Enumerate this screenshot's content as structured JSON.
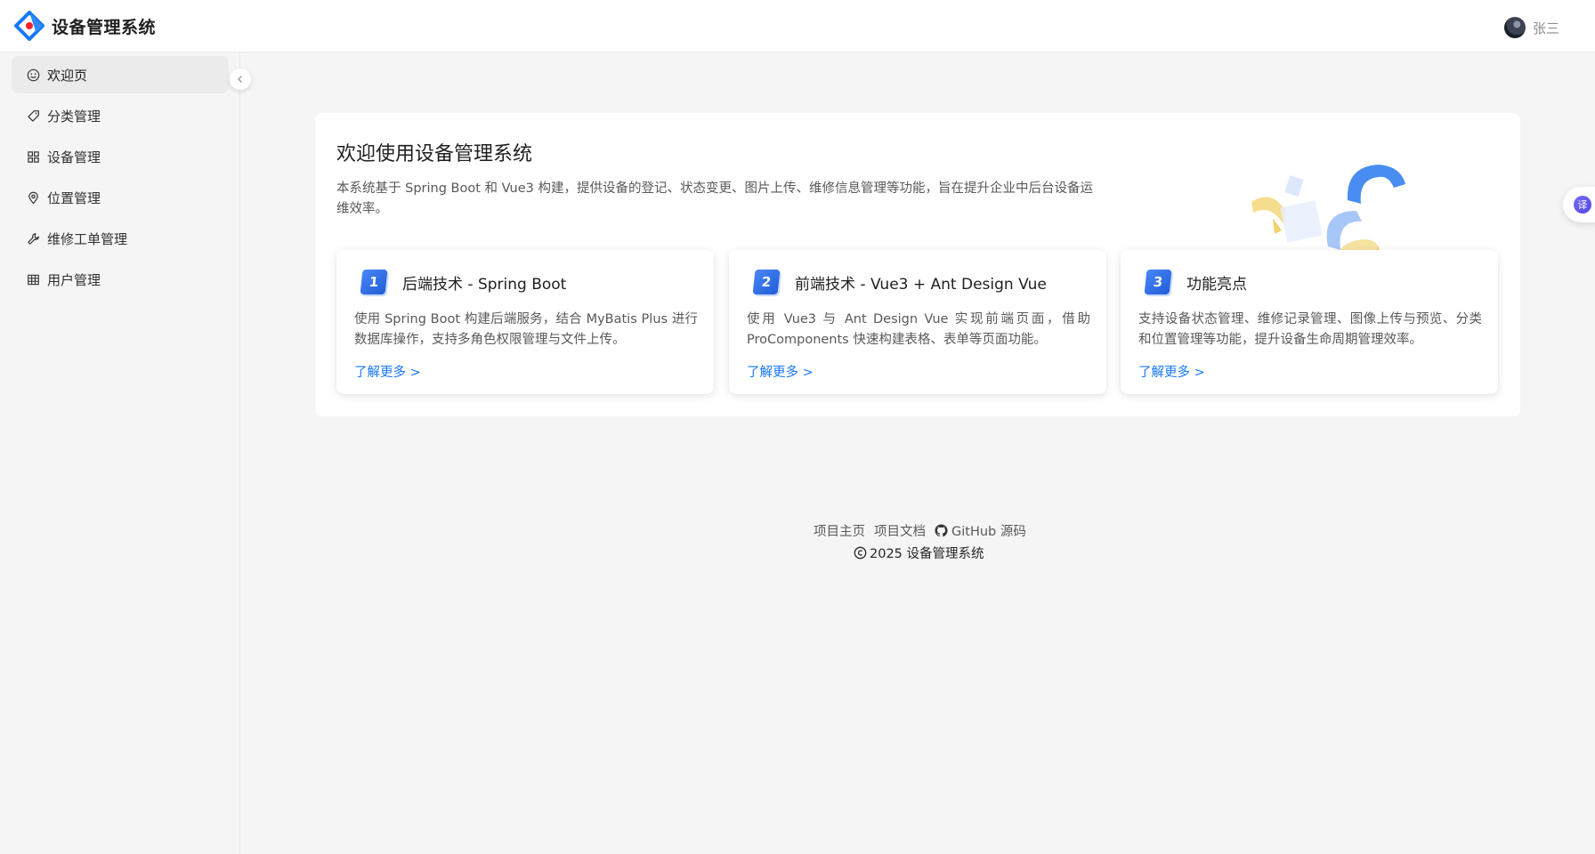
{
  "header": {
    "app_title": "设备管理系统",
    "user_name": "张三"
  },
  "sidebar": {
    "items": [
      {
        "label": "欢迎页",
        "icon": "smile-icon",
        "active": true
      },
      {
        "label": "分类管理",
        "icon": "tag-icon",
        "active": false
      },
      {
        "label": "设备管理",
        "icon": "appstore-icon",
        "active": false
      },
      {
        "label": "位置管理",
        "icon": "location-pin-icon",
        "active": false
      },
      {
        "label": "维修工单管理",
        "icon": "wrench-icon",
        "active": false
      },
      {
        "label": "用户管理",
        "icon": "table-icon",
        "active": false
      }
    ]
  },
  "welcome": {
    "title": "欢迎使用设备管理系统",
    "description": "本系统基于 Spring Boot 和 Vue3 构建，提供设备的登记、状态变更、图片上传、维修信息管理等功能，旨在提升企业中后台设备运维效率。"
  },
  "features": [
    {
      "num": "1",
      "title": "后端技术 - Spring Boot",
      "desc": "使用 Spring Boot 构建后端服务，结合 MyBatis Plus 进行数据库操作，支持多角色权限管理与文件上传。",
      "link": "了解更多 >"
    },
    {
      "num": "2",
      "title": "前端技术 - Vue3 + Ant Design Vue",
      "desc": "使用 Vue3 与 Ant Design Vue 实现前端页面，借助 ProComponents 快速构建表格、表单等页面功能。",
      "link": "了解更多 >"
    },
    {
      "num": "3",
      "title": "功能亮点",
      "desc": "支持设备状态管理、维修记录管理、图像上传与预览、分类和位置管理等功能，提升设备生命周期管理效率。",
      "link": "了解更多 >"
    }
  ],
  "footer": {
    "links": [
      "项目主页",
      "项目文档",
      "GitHub 源码"
    ],
    "copyright": "2025 设备管理系统"
  },
  "translate_fab": {
    "label": "译"
  },
  "colors": {
    "accent": "#1677ff",
    "background": "#f5f5f5",
    "card": "#ffffff"
  }
}
